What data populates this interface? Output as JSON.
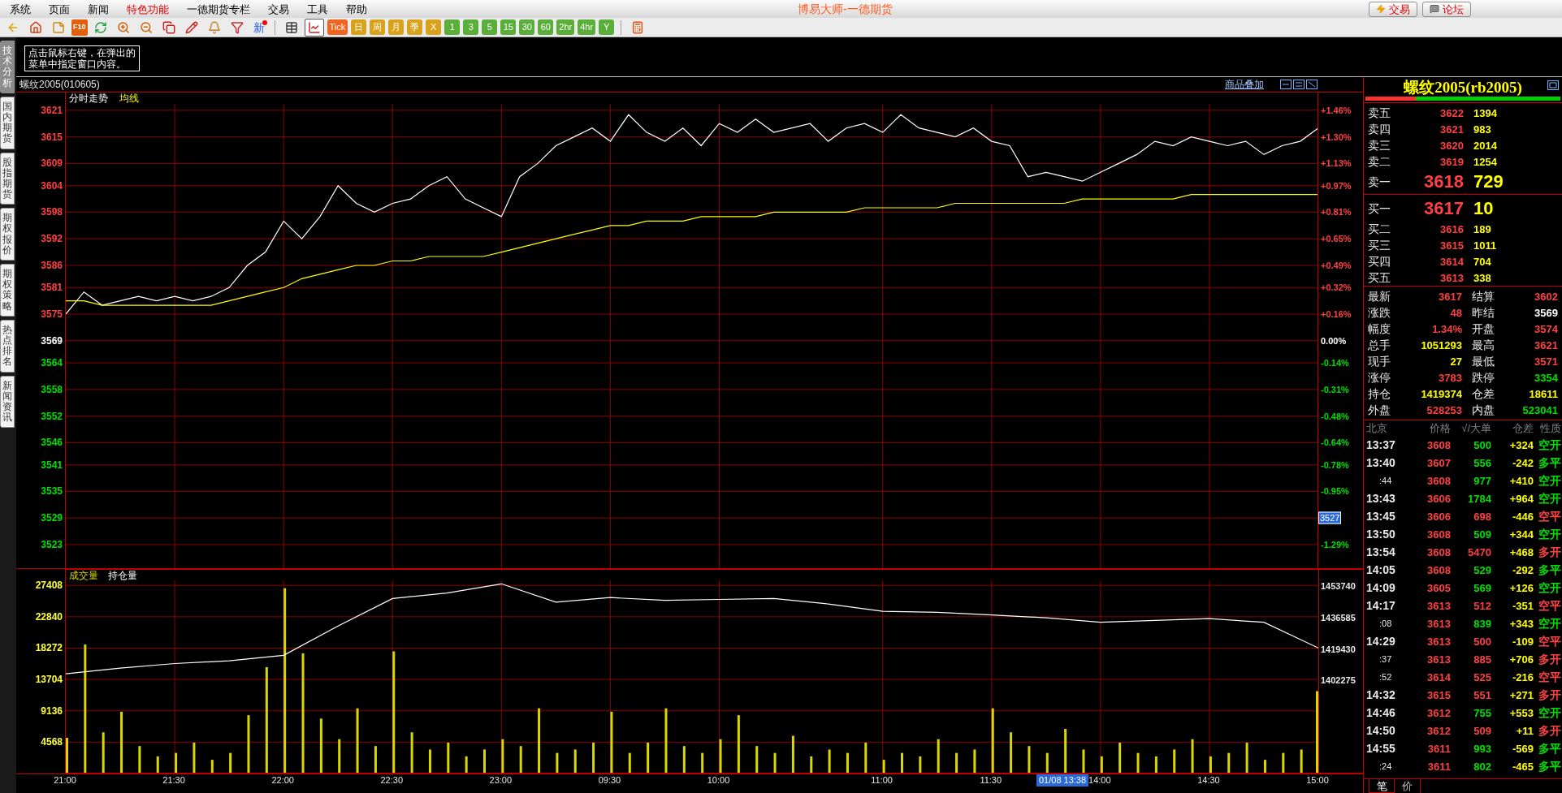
{
  "menu": {
    "items": [
      {
        "label": "系统",
        "highlight": false
      },
      {
        "label": "页面",
        "highlight": false
      },
      {
        "label": "新闻",
        "highlight": false
      },
      {
        "label": "特色功能",
        "highlight": true
      },
      {
        "label": "一德期货专栏",
        "highlight": false
      },
      {
        "label": "交易",
        "highlight": false
      },
      {
        "label": "工具",
        "highlight": false
      },
      {
        "label": "帮助",
        "highlight": false
      }
    ],
    "title": "博易大师-一德期货",
    "buttons": [
      {
        "kind": "trade",
        "label": "交易"
      },
      {
        "kind": "forum",
        "label": "论坛"
      }
    ]
  },
  "toolbar": [
    {
      "kind": "back"
    },
    {
      "kind": "home"
    },
    {
      "kind": "notes"
    },
    {
      "kind": "f10",
      "label": "F10"
    },
    {
      "kind": "refresh"
    },
    {
      "kind": "zoom_in"
    },
    {
      "kind": "zoom_out"
    },
    {
      "kind": "windows"
    },
    {
      "kind": "pen"
    },
    {
      "kind": "bell"
    },
    {
      "kind": "filter"
    },
    {
      "kind": "news",
      "label": "新"
    },
    {
      "kind": "separator"
    },
    {
      "kind": "table",
      "selected": false
    },
    {
      "kind": "chart",
      "selected": true
    },
    {
      "kind": "tile",
      "label": "Tick",
      "color": "#f0641e",
      "selected": false
    },
    {
      "kind": "tile",
      "label": "日",
      "color": "#d9a21b",
      "selected": false
    },
    {
      "kind": "tile",
      "label": "周",
      "color": "#d9a21b",
      "selected": false
    },
    {
      "kind": "tile",
      "label": "月",
      "color": "#d9a21b",
      "selected": false
    },
    {
      "kind": "tile",
      "label": "季",
      "color": "#d9a21b",
      "selected": false
    },
    {
      "kind": "tile",
      "label": "X",
      "color": "#d9a21b",
      "selected": false
    },
    {
      "kind": "tile",
      "label": "1",
      "color": "#5aae3a",
      "selected": false
    },
    {
      "kind": "tile",
      "label": "3",
      "color": "#5aae3a",
      "selected": false
    },
    {
      "kind": "tile",
      "label": "5",
      "color": "#5aae3a",
      "selected": false
    },
    {
      "kind": "tile",
      "label": "15",
      "color": "#5aae3a",
      "selected": false
    },
    {
      "kind": "tile",
      "label": "30",
      "color": "#5aae3a",
      "selected": false
    },
    {
      "kind": "tile",
      "label": "60",
      "color": "#5aae3a",
      "selected": false
    },
    {
      "kind": "tile",
      "label": "2hr",
      "color": "#5aae3a",
      "selected": false
    },
    {
      "kind": "tile",
      "label": "4hr",
      "color": "#5aae3a",
      "selected": false
    },
    {
      "kind": "tile",
      "label": "Y",
      "color": "#5aae3a",
      "selected": false
    },
    {
      "kind": "separator"
    },
    {
      "kind": "calc"
    }
  ],
  "side_tabs": [
    {
      "label": "技术分析",
      "selected": true
    },
    {
      "label": "国内期货",
      "selected": false
    },
    {
      "label": "股指期货",
      "selected": false
    },
    {
      "label": "期权报价",
      "selected": false
    },
    {
      "label": "期权策略",
      "selected": false
    },
    {
      "label": "热点排名",
      "selected": false
    },
    {
      "label": "新闻资讯",
      "selected": false
    }
  ],
  "tooltip": "点击鼠标右键，在弹出的菜单中指定窗口内容。",
  "chart_panel": {
    "title": "螺纹2005(010605)",
    "overlay_link": "商品叠加",
    "price": {
      "chart_data": {
        "type": "line",
        "grid": true,
        "ylim": [
          3517.5,
          3625
        ],
        "yticks": [
          {
            "value": 3621,
            "label": "3621"
          },
          {
            "value": 3615,
            "label": "3615"
          },
          {
            "value": 3609,
            "label": "3609"
          },
          {
            "value": 3604,
            "label": "3604"
          },
          {
            "value": 3598,
            "label": "3598"
          },
          {
            "value": 3592,
            "label": "3592"
          },
          {
            "value": 3586,
            "label": "3586"
          },
          {
            "value": 3581,
            "label": "3581"
          },
          {
            "value": 3575,
            "label": "3575"
          },
          {
            "value": 3569,
            "label": "3569"
          },
          {
            "value": 3564,
            "label": "3564"
          },
          {
            "value": 3558,
            "label": "3558"
          },
          {
            "value": 3552,
            "label": "3552"
          },
          {
            "value": 3546,
            "label": "3546"
          },
          {
            "value": 3541,
            "label": "3541"
          },
          {
            "value": 3535,
            "label": "3535"
          },
          {
            "value": 3529,
            "label": "3529"
          },
          {
            "value": 3523,
            "label": "3523"
          }
        ],
        "series": [
          {
            "name": "分时走势",
            "color": "#ffffff",
            "values": [
              3575,
              3580,
              3577,
              3578,
              3579,
              3578,
              3579,
              3578,
              3579,
              3581,
              3586,
              3589,
              3596,
              3592,
              3597,
              3604,
              3600,
              3598,
              3600,
              3601,
              3604,
              3606,
              3601,
              3599,
              3597,
              3606,
              3609,
              3613,
              3615,
              3617,
              3614,
              3620,
              3616,
              3614,
              3617,
              3613,
              3618,
              3616,
              3619,
              3616,
              3617,
              3618,
              3614,
              3617,
              3618,
              3616,
              3620,
              3617,
              3616,
              3615,
              3617,
              3614,
              3613,
              3606,
              3607,
              3606,
              3605,
              3607,
              3609,
              3611,
              3614,
              3613,
              3615,
              3614,
              3613,
              3614,
              3611,
              3613,
              3614,
              3617
            ]
          },
          {
            "name": "均线",
            "color": "#ffff00",
            "values": [
              3578,
              3578,
              3577,
              3577,
              3577,
              3577,
              3577,
              3577,
              3577,
              3578,
              3579,
              3580,
              3581,
              3583,
              3584,
              3585,
              3586,
              3586,
              3587,
              3587,
              3588,
              3588,
              3588,
              3588,
              3589,
              3590,
              3591,
              3592,
              3593,
              3594,
              3595,
              3595,
              3596,
              3596,
              3596,
              3597,
              3597,
              3597,
              3597,
              3598,
              3598,
              3598,
              3598,
              3598,
              3599,
              3599,
              3599,
              3599,
              3599,
              3600,
              3600,
              3600,
              3600,
              3600,
              3600,
              3600,
              3601,
              3601,
              3601,
              3601,
              3601,
              3601,
              3602,
              3602,
              3602,
              3602,
              3602,
              3602,
              3602,
              3602
            ]
          }
        ]
      },
      "percent_axis": [
        {
          "kind": "tick",
          "label": "+1.46%",
          "color": "#ff4040"
        },
        {
          "kind": "tick",
          "label": "+1.30%",
          "color": "#ff4040"
        },
        {
          "kind": "tick",
          "label": "+1.13%",
          "color": "#ff4040"
        },
        {
          "kind": "tick",
          "label": "+0.97%",
          "color": "#ff4040"
        },
        {
          "kind": "tick",
          "label": "+0.81%",
          "color": "#ff4040"
        },
        {
          "kind": "tick",
          "label": "+0.65%",
          "color": "#ff4040"
        },
        {
          "kind": "tick",
          "label": "+0.49%",
          "color": "#ff4040"
        },
        {
          "kind": "tick",
          "label": "+0.32%",
          "color": "#ff4040"
        },
        {
          "kind": "tick",
          "label": "+0.16%",
          "color": "#ff4040"
        },
        {
          "kind": "tick",
          "label": "0.00%",
          "color": "#ffffff"
        },
        {
          "kind": "tick",
          "label": "-0.14%",
          "color": "#00e000"
        },
        {
          "kind": "tick",
          "label": "-0.31%",
          "color": "#00e000"
        },
        {
          "kind": "tick",
          "label": "-0.48%",
          "color": "#00e000"
        },
        {
          "kind": "tick",
          "label": "-0.64%",
          "color": "#00e000"
        },
        {
          "kind": "tick",
          "label": "-0.78%",
          "color": "#00e000"
        },
        {
          "kind": "tick",
          "label": "-0.95%",
          "color": "#00e000"
        },
        {
          "kind": "cursor",
          "label": "3527",
          "color": "#00e000"
        },
        {
          "kind": "tick",
          "label": "-1.29%",
          "color": "#00e000"
        }
      ]
    },
    "volume": {
      "chart_data": {
        "type": "bar",
        "grid": true,
        "ylim": [
          0,
          29800
        ],
        "categories": [
          "21:00",
          null,
          null,
          null,
          null,
          null,
          "21:30",
          null,
          null,
          null,
          null,
          null,
          "22:00",
          null,
          null,
          null,
          null,
          null,
          "22:30",
          null,
          null,
          null,
          null,
          null,
          "23:00",
          null,
          null,
          null,
          null,
          null,
          "09:30",
          null,
          null,
          null,
          null,
          null,
          "10:00",
          null,
          null,
          null,
          null,
          null,
          null,
          null,
          null,
          "11:00",
          null,
          null,
          null,
          null,
          null,
          "11:30",
          null,
          null,
          null,
          null,
          null,
          "14:00",
          null,
          null,
          null,
          null,
          null,
          "14:30",
          null,
          null,
          null,
          null,
          null,
          "15:00"
        ],
        "yticks": [
          {
            "value": 27408,
            "label": "27408"
          },
          {
            "value": 22840,
            "label": "22840"
          },
          {
            "value": 18272,
            "label": "18272"
          },
          {
            "value": 13704,
            "label": "13704"
          },
          {
            "value": 9136,
            "label": "9136"
          },
          {
            "value": 4568,
            "label": "4568"
          }
        ],
        "series": [
          {
            "name": "成交量",
            "color": "#d8d800",
            "values": [
              5200,
              18800,
              6000,
              9000,
              4000,
              2500,
              3000,
              4500,
              2000,
              3000,
              8500,
              15500,
              27000,
              17500,
              8000,
              5000,
              9500,
              4000,
              17800,
              6000,
              3500,
              4500,
              2500,
              3500,
              5000,
              4000,
              9500,
              3000,
              3500,
              4500,
              9000,
              3000,
              4500,
              9500,
              4000,
              3000,
              5000,
              8500,
              4000,
              3000,
              5500,
              2500,
              3500,
              3000,
              4500,
              2000,
              3000,
              2500,
              5000,
              3000,
              3500,
              9500,
              6000,
              4000,
              3000,
              6500,
              3500,
              2500,
              4500,
              3000,
              2500,
              3500,
              5000,
              2500,
              3000,
              4500,
              2000,
              3000,
              3500,
              12000
            ]
          }
        ],
        "annotations": [
          {
            "text": "01/08 13:38"
          }
        ]
      }
    },
    "open_interest": {
      "chart_data": {
        "type": "line",
        "ylim": [
          1350990,
          1462675
        ],
        "yticks": [
          {
            "value": 1453740,
            "label": "1453740"
          },
          {
            "value": 1436585,
            "label": "1436585"
          },
          {
            "value": 1419430,
            "label": "1419430"
          },
          {
            "value": 1402275,
            "label": "1402275"
          }
        ],
        "series": [
          {
            "name": "持仓量",
            "color": "#ffffff",
            "values": [
              1405900,
              1409000,
              1411500,
              1413000,
              1416000,
              1432000,
              1447000,
              1450000,
              1455000,
              1445000,
              1447500,
              1446000,
              1446500,
              1447000,
              1444000,
              1440000,
              1439500,
              1438000,
              1436500,
              1434000,
              1435000,
              1436000,
              1434000,
              1420000
            ]
          }
        ]
      }
    }
  },
  "quote": {
    "title": "螺纹2005(rb2005)",
    "ratio_bar": {
      "level": 0.26
    },
    "asks": [
      {
        "label": "卖五",
        "price": "3622",
        "volume": "1394",
        "kind": "level"
      },
      {
        "label": "卖四",
        "price": "3621",
        "volume": "983",
        "kind": "level"
      },
      {
        "label": "卖三",
        "price": "3620",
        "volume": "2014",
        "kind": "level"
      },
      {
        "label": "卖二",
        "price": "3619",
        "volume": "1254",
        "kind": "level"
      },
      {
        "label": "卖一",
        "price": "3618",
        "volume": "729",
        "kind": "best"
      }
    ],
    "bids": [
      {
        "label": "买一",
        "price": "3617",
        "volume": "10",
        "kind": "best"
      },
      {
        "label": "买二",
        "price": "3616",
        "volume": "189",
        "kind": "level"
      },
      {
        "label": "买三",
        "price": "3615",
        "volume": "1011",
        "kind": "level"
      },
      {
        "label": "买四",
        "price": "3614",
        "volume": "704",
        "kind": "level"
      },
      {
        "label": "买五",
        "price": "3613",
        "volume": "338",
        "kind": "level"
      }
    ],
    "stats": [
      {
        "left": {
          "label": "最新",
          "value": "3617",
          "color": "#ff4040"
        },
        "right": {
          "label": "结算",
          "value": "3602",
          "color": "#ff4040"
        }
      },
      {
        "left": {
          "label": "涨跌",
          "value": "48",
          "color": "#ff4040"
        },
        "right": {
          "label": "昨结",
          "value": "3569",
          "color": "#ffffff"
        }
      },
      {
        "left": {
          "label": "幅度",
          "value": "1.34%",
          "color": "#ff4040"
        },
        "right": {
          "label": "开盘",
          "value": "3574",
          "color": "#ff4040"
        }
      },
      {
        "left": {
          "label": "总手",
          "value": "1051293",
          "color": "#ffff00"
        },
        "right": {
          "label": "最高",
          "value": "3621",
          "color": "#ff4040"
        }
      },
      {
        "left": {
          "label": "现手",
          "value": "27",
          "color": "#ffff00"
        },
        "right": {
          "label": "最低",
          "value": "3571",
          "color": "#ff4040"
        }
      },
      {
        "left": {
          "label": "涨停",
          "value": "3783",
          "color": "#ff4040"
        },
        "right": {
          "label": "跌停",
          "value": "3354",
          "color": "#00e000"
        }
      },
      {
        "left": {
          "label": "持仓",
          "value": "1419374",
          "color": "#ffff00"
        },
        "right": {
          "label": "仓差",
          "value": "18611",
          "color": "#ffff00"
        }
      },
      {
        "left": {
          "label": "外盘",
          "value": "528253",
          "color": "#ff4040"
        },
        "right": {
          "label": "内盘",
          "value": "523041",
          "color": "#00e000"
        }
      }
    ],
    "trades": {
      "columns": [
        "北京",
        "价格",
        "√/大单",
        "仓差",
        "性质"
      ],
      "rows": [
        {
          "time": "13:37",
          "kind": "full",
          "price": "3608",
          "volume": {
            "text": "500",
            "color": "#00e000"
          },
          "change": "+324",
          "type": {
            "text": "空开",
            "color": "#00e000"
          }
        },
        {
          "time": "13:40",
          "kind": "full",
          "price": "3607",
          "volume": {
            "text": "556",
            "color": "#00e000"
          },
          "change": "-242",
          "type": {
            "text": "多平",
            "color": "#00e000"
          }
        },
        {
          "time": ":44",
          "kind": "seconds",
          "price": "3608",
          "volume": {
            "text": "977",
            "color": "#00e000"
          },
          "change": "+410",
          "type": {
            "text": "空开",
            "color": "#00e000"
          }
        },
        {
          "time": "13:43",
          "kind": "full",
          "price": "3606",
          "volume": {
            "text": "1784",
            "color": "#00e000"
          },
          "change": "+964",
          "type": {
            "text": "空开",
            "color": "#00e000"
          }
        },
        {
          "time": "13:45",
          "kind": "full",
          "price": "3606",
          "volume": {
            "text": "698",
            "color": "#ff4040"
          },
          "change": "-446",
          "type": {
            "text": "空平",
            "color": "#ff4040"
          }
        },
        {
          "time": "13:50",
          "kind": "full",
          "price": "3608",
          "volume": {
            "text": "509",
            "color": "#00e000"
          },
          "change": "+344",
          "type": {
            "text": "空开",
            "color": "#00e000"
          }
        },
        {
          "time": "13:54",
          "kind": "full",
          "price": "3608",
          "volume": {
            "text": "5470",
            "color": "#ff4040"
          },
          "change": "+468",
          "type": {
            "text": "多开",
            "color": "#ff4040"
          }
        },
        {
          "time": "14:05",
          "kind": "full",
          "price": "3608",
          "volume": {
            "text": "529",
            "color": "#00e000"
          },
          "change": "-292",
          "type": {
            "text": "多平",
            "color": "#00e000"
          }
        },
        {
          "time": "14:09",
          "kind": "full",
          "price": "3605",
          "volume": {
            "text": "569",
            "color": "#00e000"
          },
          "change": "+126",
          "type": {
            "text": "空开",
            "color": "#00e000"
          }
        },
        {
          "time": "14:17",
          "kind": "full",
          "price": "3613",
          "volume": {
            "text": "512",
            "color": "#ff4040"
          },
          "change": "-351",
          "type": {
            "text": "空平",
            "color": "#ff4040"
          }
        },
        {
          "time": ":08",
          "kind": "seconds",
          "price": "3613",
          "volume": {
            "text": "839",
            "color": "#00e000"
          },
          "change": "+343",
          "type": {
            "text": "空开",
            "color": "#00e000"
          }
        },
        {
          "time": "14:29",
          "kind": "full",
          "price": "3613",
          "volume": {
            "text": "500",
            "color": "#ff4040"
          },
          "change": "-109",
          "type": {
            "text": "空平",
            "color": "#ff4040"
          }
        },
        {
          "time": ":37",
          "kind": "seconds",
          "price": "3613",
          "volume": {
            "text": "885",
            "color": "#ff4040"
          },
          "change": "+706",
          "type": {
            "text": "多开",
            "color": "#ff4040"
          }
        },
        {
          "time": ":52",
          "kind": "seconds",
          "price": "3614",
          "volume": {
            "text": "525",
            "color": "#ff4040"
          },
          "change": "-216",
          "type": {
            "text": "空平",
            "color": "#ff4040"
          }
        },
        {
          "time": "14:32",
          "kind": "full",
          "price": "3615",
          "volume": {
            "text": "551",
            "color": "#ff4040"
          },
          "change": "+271",
          "type": {
            "text": "多开",
            "color": "#ff4040"
          }
        },
        {
          "time": "14:46",
          "kind": "full",
          "price": "3612",
          "volume": {
            "text": "755",
            "color": "#00e000"
          },
          "change": "+553",
          "type": {
            "text": "空开",
            "color": "#00e000"
          }
        },
        {
          "time": "14:50",
          "kind": "full",
          "price": "3612",
          "volume": {
            "text": "509",
            "color": "#ff4040"
          },
          "change": "+11",
          "type": {
            "text": "多开",
            "color": "#ff4040"
          }
        },
        {
          "time": "14:55",
          "kind": "full",
          "price": "3611",
          "volume": {
            "text": "993",
            "color": "#00e000"
          },
          "change": "-569",
          "type": {
            "text": "多平",
            "color": "#00e000"
          }
        },
        {
          "time": ":24",
          "kind": "seconds",
          "price": "3611",
          "volume": {
            "text": "802",
            "color": "#00e000"
          },
          "change": "-465",
          "type": {
            "text": "多平",
            "color": "#00e000"
          }
        }
      ]
    },
    "tabs": [
      {
        "label": "笔",
        "selected": true
      },
      {
        "label": "价",
        "selected": false
      }
    ]
  }
}
